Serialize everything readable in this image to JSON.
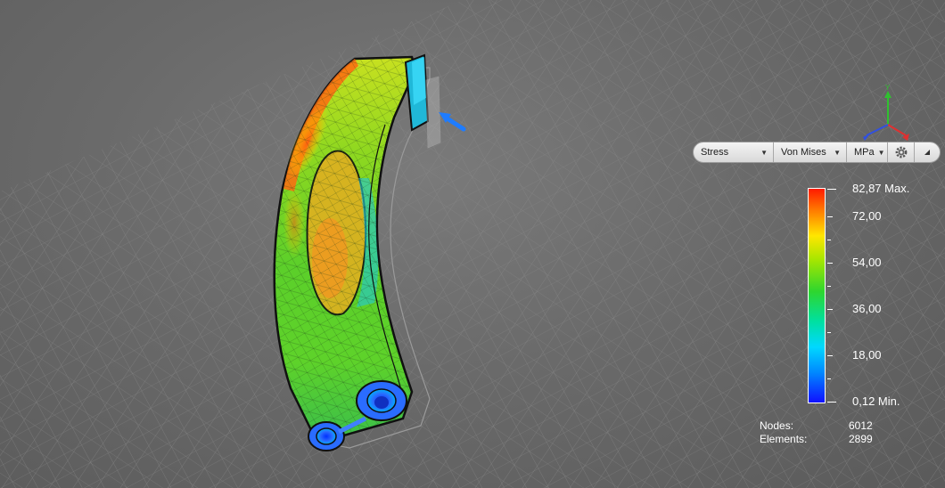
{
  "toolbar": {
    "result_type": "Stress",
    "component": "Von Mises",
    "unit": "MPa"
  },
  "icons": {
    "settings": "gear-icon",
    "collapse": "collapse-triangle-icon",
    "load_arrow": "load-arrow-icon",
    "view_triad": "axis-triad-icon"
  },
  "triad": {
    "y_label": "Y"
  },
  "legend": {
    "max_label": "82,87 Max.",
    "min_label": "0,12 Min.",
    "ticks": [
      "72,00",
      "54,00",
      "36,00",
      "18,00"
    ],
    "colors": [
      "#ff1a00",
      "#ff7a00",
      "#ffe600",
      "#2ed62e",
      "#00d8ff",
      "#0088ff",
      "#1010ff"
    ]
  },
  "stats": {
    "nodes_label": "Nodes:",
    "nodes_value": "6012",
    "elements_label": "Elements:",
    "elements_value": "2899"
  }
}
